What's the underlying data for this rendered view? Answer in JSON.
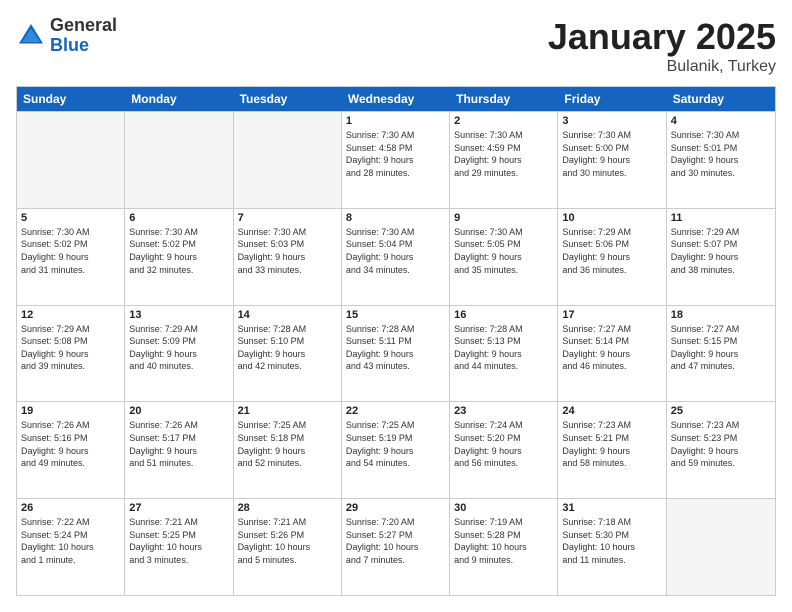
{
  "header": {
    "logo": {
      "general": "General",
      "blue": "Blue"
    },
    "title": "January 2025",
    "location": "Bulanik, Turkey"
  },
  "calendar": {
    "days_of_week": [
      "Sunday",
      "Monday",
      "Tuesday",
      "Wednesday",
      "Thursday",
      "Friday",
      "Saturday"
    ],
    "rows": [
      [
        {
          "day": "",
          "text": "",
          "empty": true
        },
        {
          "day": "",
          "text": "",
          "empty": true
        },
        {
          "day": "",
          "text": "",
          "empty": true
        },
        {
          "day": "1",
          "text": "Sunrise: 7:30 AM\nSunset: 4:58 PM\nDaylight: 9 hours\nand 28 minutes.",
          "empty": false
        },
        {
          "day": "2",
          "text": "Sunrise: 7:30 AM\nSunset: 4:59 PM\nDaylight: 9 hours\nand 29 minutes.",
          "empty": false
        },
        {
          "day": "3",
          "text": "Sunrise: 7:30 AM\nSunset: 5:00 PM\nDaylight: 9 hours\nand 30 minutes.",
          "empty": false
        },
        {
          "day": "4",
          "text": "Sunrise: 7:30 AM\nSunset: 5:01 PM\nDaylight: 9 hours\nand 30 minutes.",
          "empty": false
        }
      ],
      [
        {
          "day": "5",
          "text": "Sunrise: 7:30 AM\nSunset: 5:02 PM\nDaylight: 9 hours\nand 31 minutes.",
          "empty": false
        },
        {
          "day": "6",
          "text": "Sunrise: 7:30 AM\nSunset: 5:02 PM\nDaylight: 9 hours\nand 32 minutes.",
          "empty": false
        },
        {
          "day": "7",
          "text": "Sunrise: 7:30 AM\nSunset: 5:03 PM\nDaylight: 9 hours\nand 33 minutes.",
          "empty": false
        },
        {
          "day": "8",
          "text": "Sunrise: 7:30 AM\nSunset: 5:04 PM\nDaylight: 9 hours\nand 34 minutes.",
          "empty": false
        },
        {
          "day": "9",
          "text": "Sunrise: 7:30 AM\nSunset: 5:05 PM\nDaylight: 9 hours\nand 35 minutes.",
          "empty": false
        },
        {
          "day": "10",
          "text": "Sunrise: 7:29 AM\nSunset: 5:06 PM\nDaylight: 9 hours\nand 36 minutes.",
          "empty": false
        },
        {
          "day": "11",
          "text": "Sunrise: 7:29 AM\nSunset: 5:07 PM\nDaylight: 9 hours\nand 38 minutes.",
          "empty": false
        }
      ],
      [
        {
          "day": "12",
          "text": "Sunrise: 7:29 AM\nSunset: 5:08 PM\nDaylight: 9 hours\nand 39 minutes.",
          "empty": false
        },
        {
          "day": "13",
          "text": "Sunrise: 7:29 AM\nSunset: 5:09 PM\nDaylight: 9 hours\nand 40 minutes.",
          "empty": false
        },
        {
          "day": "14",
          "text": "Sunrise: 7:28 AM\nSunset: 5:10 PM\nDaylight: 9 hours\nand 42 minutes.",
          "empty": false
        },
        {
          "day": "15",
          "text": "Sunrise: 7:28 AM\nSunset: 5:11 PM\nDaylight: 9 hours\nand 43 minutes.",
          "empty": false
        },
        {
          "day": "16",
          "text": "Sunrise: 7:28 AM\nSunset: 5:13 PM\nDaylight: 9 hours\nand 44 minutes.",
          "empty": false
        },
        {
          "day": "17",
          "text": "Sunrise: 7:27 AM\nSunset: 5:14 PM\nDaylight: 9 hours\nand 46 minutes.",
          "empty": false
        },
        {
          "day": "18",
          "text": "Sunrise: 7:27 AM\nSunset: 5:15 PM\nDaylight: 9 hours\nand 47 minutes.",
          "empty": false
        }
      ],
      [
        {
          "day": "19",
          "text": "Sunrise: 7:26 AM\nSunset: 5:16 PM\nDaylight: 9 hours\nand 49 minutes.",
          "empty": false
        },
        {
          "day": "20",
          "text": "Sunrise: 7:26 AM\nSunset: 5:17 PM\nDaylight: 9 hours\nand 51 minutes.",
          "empty": false
        },
        {
          "day": "21",
          "text": "Sunrise: 7:25 AM\nSunset: 5:18 PM\nDaylight: 9 hours\nand 52 minutes.",
          "empty": false
        },
        {
          "day": "22",
          "text": "Sunrise: 7:25 AM\nSunset: 5:19 PM\nDaylight: 9 hours\nand 54 minutes.",
          "empty": false
        },
        {
          "day": "23",
          "text": "Sunrise: 7:24 AM\nSunset: 5:20 PM\nDaylight: 9 hours\nand 56 minutes.",
          "empty": false
        },
        {
          "day": "24",
          "text": "Sunrise: 7:23 AM\nSunset: 5:21 PM\nDaylight: 9 hours\nand 58 minutes.",
          "empty": false
        },
        {
          "day": "25",
          "text": "Sunrise: 7:23 AM\nSunset: 5:23 PM\nDaylight: 9 hours\nand 59 minutes.",
          "empty": false
        }
      ],
      [
        {
          "day": "26",
          "text": "Sunrise: 7:22 AM\nSunset: 5:24 PM\nDaylight: 10 hours\nand 1 minute.",
          "empty": false
        },
        {
          "day": "27",
          "text": "Sunrise: 7:21 AM\nSunset: 5:25 PM\nDaylight: 10 hours\nand 3 minutes.",
          "empty": false
        },
        {
          "day": "28",
          "text": "Sunrise: 7:21 AM\nSunset: 5:26 PM\nDaylight: 10 hours\nand 5 minutes.",
          "empty": false
        },
        {
          "day": "29",
          "text": "Sunrise: 7:20 AM\nSunset: 5:27 PM\nDaylight: 10 hours\nand 7 minutes.",
          "empty": false
        },
        {
          "day": "30",
          "text": "Sunrise: 7:19 AM\nSunset: 5:28 PM\nDaylight: 10 hours\nand 9 minutes.",
          "empty": false
        },
        {
          "day": "31",
          "text": "Sunrise: 7:18 AM\nSunset: 5:30 PM\nDaylight: 10 hours\nand 11 minutes.",
          "empty": false
        },
        {
          "day": "",
          "text": "",
          "empty": true,
          "shaded": true
        }
      ]
    ]
  }
}
